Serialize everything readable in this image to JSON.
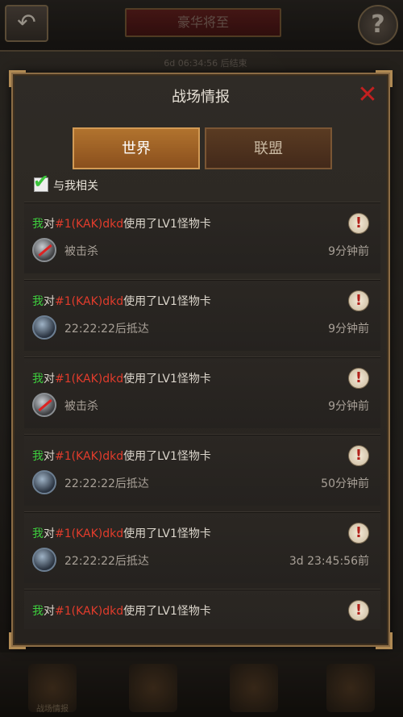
{
  "background": {
    "top_title": "豪华将至",
    "top_timer": "6d 06:34:56 后结束",
    "bottom_labels": [
      "战场情报",
      "",
      "",
      ""
    ]
  },
  "panel": {
    "title": "战场情报",
    "close_label": "✕",
    "tabs": [
      {
        "label": "世界",
        "active": true
      },
      {
        "label": "联盟",
        "active": false
      }
    ],
    "filter_label": "与我相关",
    "filter_checked": true
  },
  "entries": [
    {
      "me": "我",
      "verb": "对",
      "target": "#1(KAK)dkd",
      "action": "使用了LV1怪物卡",
      "status": "被击杀",
      "status_type": "killed",
      "time": "9分钟前"
    },
    {
      "me": "我",
      "verb": "对",
      "target": "#1(KAK)dkd",
      "action": "使用了LV1怪物卡",
      "status": "22:22:22后抵达",
      "status_type": "arrive",
      "time": "9分钟前"
    },
    {
      "me": "我",
      "verb": "对",
      "target": "#1(KAK)dkd",
      "action": "使用了LV1怪物卡",
      "status": "被击杀",
      "status_type": "killed",
      "time": "9分钟前"
    },
    {
      "me": "我",
      "verb": "对",
      "target": "#1(KAK)dkd",
      "action": "使用了LV1怪物卡",
      "status": "22:22:22后抵达",
      "status_type": "arrive",
      "time": "50分钟前"
    },
    {
      "me": "我",
      "verb": "对",
      "target": "#1(KAK)dkd",
      "action": "使用了LV1怪物卡",
      "status": "22:22:22后抵达",
      "status_type": "arrive",
      "time": "3d 23:45:56前"
    },
    {
      "me": "我",
      "verb": "对",
      "target": "#1(KAK)dkd",
      "action": "使用了LV1怪物卡",
      "status": "",
      "status_type": "",
      "time": ""
    }
  ],
  "icons": {
    "warning": "!",
    "back": "↶",
    "help": "?"
  },
  "colors": {
    "me": "#3ecf3e",
    "target": "#e23c2c",
    "accent_tab": "#b1732e",
    "close": "#c22020"
  }
}
